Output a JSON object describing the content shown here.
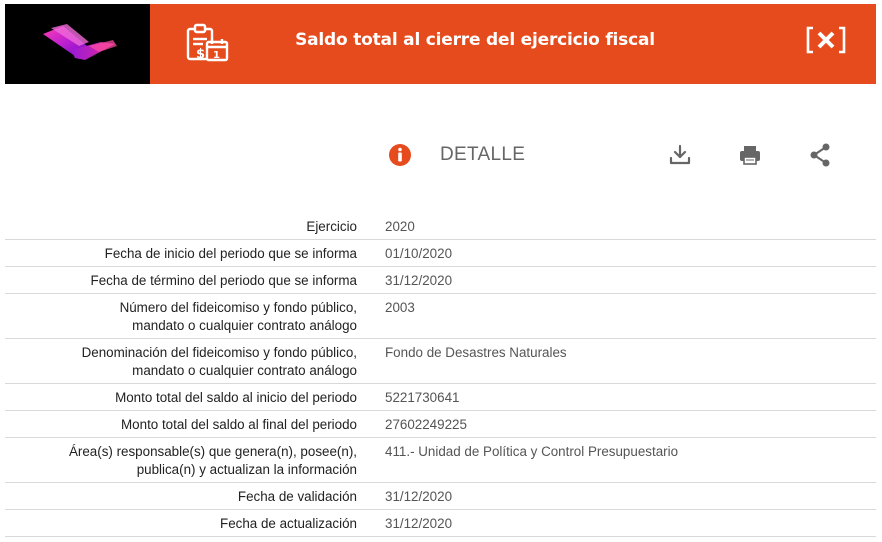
{
  "header": {
    "title": "Saldo total al cierre del ejercicio fiscal",
    "close_label": "[✕]",
    "colors": {
      "bar": "#e64b1e",
      "logo_bg": "#000000"
    },
    "icons": {
      "logo": "brand-logo",
      "report": "clipboard-calendar-icon",
      "close": "close-icon"
    }
  },
  "toolbar": {
    "detail_label": "DETALLE",
    "icons": [
      "info-icon",
      "download-icon",
      "print-icon",
      "share-icon"
    ],
    "info_color": "#e64b1e"
  },
  "details": [
    {
      "label": "Ejercicio",
      "value": "2020"
    },
    {
      "label": "Fecha de inicio del periodo que se informa",
      "value": "01/10/2020"
    },
    {
      "label": "Fecha de término del periodo que se informa",
      "value": "31/12/2020"
    },
    {
      "label": "Número del fideicomiso y fondo público, mandato o cualquier contrato análogo",
      "value": "2003"
    },
    {
      "label": "Denominación del fideicomiso y fondo público, mandato o cualquier contrato análogo",
      "value": "Fondo de Desastres Naturales"
    },
    {
      "label": "Monto total del saldo al inicio del periodo",
      "value": "5221730641"
    },
    {
      "label": "Monto total del saldo al final del periodo",
      "value": "27602249225"
    },
    {
      "label": "Área(s) responsable(s) que genera(n), posee(n), publica(n) y actualizan la información",
      "value": "411.- Unidad de Política y Control Presupuestario"
    },
    {
      "label": "Fecha de validación",
      "value": "31/12/2020"
    },
    {
      "label": "Fecha de actualización",
      "value": "31/12/2020"
    }
  ]
}
